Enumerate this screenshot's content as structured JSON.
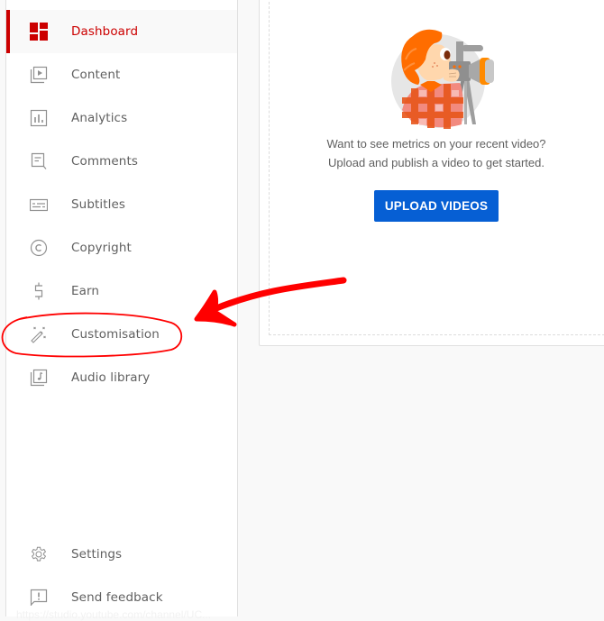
{
  "sidebar": {
    "items": [
      {
        "label": "Dashboard",
        "icon": "dashboard-icon",
        "active": true
      },
      {
        "label": "Content",
        "icon": "content-icon"
      },
      {
        "label": "Analytics",
        "icon": "analytics-icon"
      },
      {
        "label": "Comments",
        "icon": "comments-icon"
      },
      {
        "label": "Subtitles",
        "icon": "subtitles-icon"
      },
      {
        "label": "Copyright",
        "icon": "copyright-icon"
      },
      {
        "label": "Earn",
        "icon": "dollar-icon"
      },
      {
        "label": "Customisation",
        "icon": "magic-wand-icon"
      },
      {
        "label": "Audio library",
        "icon": "audio-library-icon"
      }
    ],
    "footer": [
      {
        "label": "Settings",
        "icon": "gear-icon"
      },
      {
        "label": "Send feedback",
        "icon": "feedback-icon"
      }
    ]
  },
  "main": {
    "illustration": "videographer-illustration",
    "message_line1": "Want to see metrics on your recent video?",
    "message_line2": "Upload and publish a video to get started.",
    "upload_button": "UPLOAD VIDEOS"
  },
  "status_url": "https://studio.youtube.com/channel/UC...",
  "annotation": {
    "color": "#ff0000",
    "target": "Customisation"
  },
  "colors": {
    "accent": "#cc0000",
    "button": "#065fd4"
  }
}
